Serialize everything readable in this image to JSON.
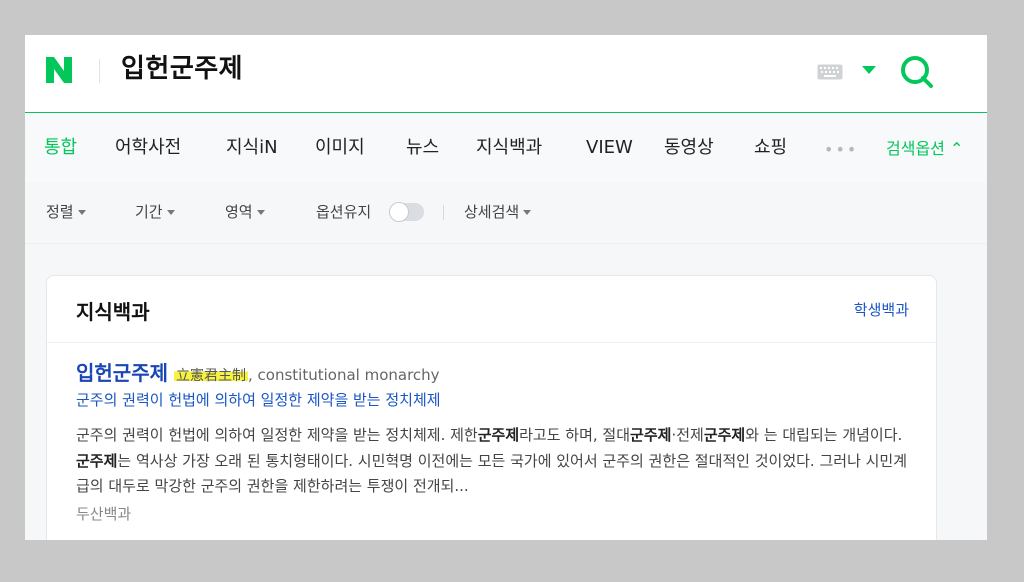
{
  "header": {
    "query": "입헌군주제",
    "logo_letter": "N",
    "logo_color": "#03c75a",
    "keyboard_icon": "keyboard-icon",
    "search_icon": "search-icon"
  },
  "tabs": [
    {
      "label": "통합",
      "active": true
    },
    {
      "label": "어학사전"
    },
    {
      "label": "지식iN"
    },
    {
      "label": "이미지"
    },
    {
      "label": "뉴스"
    },
    {
      "label": "지식백과"
    },
    {
      "label": "VIEW"
    },
    {
      "label": "동영상"
    },
    {
      "label": "쇼핑"
    },
    {
      "label": "•••"
    },
    {
      "label": "검색옵션 ⌃"
    }
  ],
  "options": {
    "sort": "정렬",
    "period": "기간",
    "area": "영역",
    "keep_option": "옵션유지",
    "detail": "상세검색"
  },
  "card": {
    "title": "지식백과",
    "link": "학생백과",
    "entry": {
      "title": "입헌군주제",
      "hanja": "立憲君主制",
      "english": ", constitutional monarchy",
      "subtitle": "군주의 권력이 헌법에 의하여 일정한 제약을 받는 정치체제",
      "description_parts": [
        "군주의 권력이 헌법에 의하여 일정한 제약을 받는 정치체제. 제한",
        "군주제",
        "라고도 하며, 절대",
        "군주제",
        "·전제",
        "군주제",
        "와 는 대립되는 개념이다. ",
        "군주제",
        "는 역사상 가장 오래 된 통치형태이다. 시민혁명 이전에는 모든 국가에 있어서 군주의 권한은 절대적인 것이었다. 그러나 시민계급의 대두로 막강한 군주의 권한을 제한하려는 투쟁이 전개되..."
      ],
      "source": "두산백과"
    }
  },
  "colors": {
    "accent": "#03c75a",
    "link": "#1a56c6",
    "highlight": "#f6f240"
  }
}
